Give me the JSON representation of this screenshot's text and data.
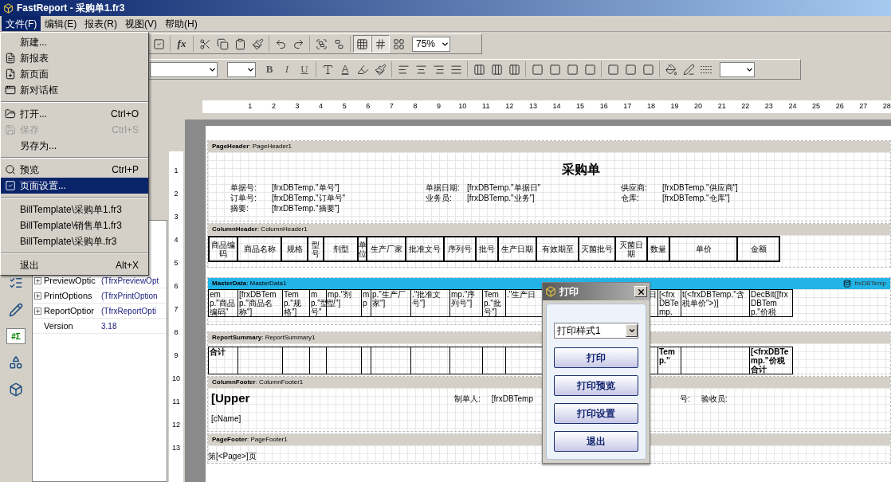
{
  "window": {
    "title": "FastReport - 采购单1.fr3"
  },
  "menu_bar": [
    {
      "label": "文件(F)",
      "selected": true
    },
    {
      "label": "编辑(E)",
      "selected": false
    },
    {
      "label": "报表(R)",
      "selected": false
    },
    {
      "label": "视图(V)",
      "selected": false
    },
    {
      "label": "帮助(H)",
      "selected": false
    }
  ],
  "file_menu": [
    {
      "kind": "item",
      "label": "新建...",
      "selected": false,
      "disabled": false
    },
    {
      "kind": "item",
      "label": "新报表",
      "selected": false,
      "disabled": false
    },
    {
      "kind": "item",
      "label": "新页面",
      "selected": false,
      "disabled": false
    },
    {
      "kind": "item",
      "label": "新对话框",
      "selected": false,
      "disabled": false
    },
    {
      "kind": "separator"
    },
    {
      "kind": "item",
      "label": "打开...",
      "shortcut": "Ctrl+O",
      "selected": false,
      "disabled": false
    },
    {
      "kind": "item",
      "label": "保存",
      "shortcut": "Ctrl+S",
      "selected": false,
      "disabled": true
    },
    {
      "kind": "item",
      "label": "另存为...",
      "selected": false,
      "disabled": false
    },
    {
      "kind": "separator"
    },
    {
      "kind": "item",
      "label": "预览",
      "shortcut": "Ctrl+P",
      "selected": false,
      "disabled": false
    },
    {
      "kind": "item",
      "label": "页面设置...",
      "selected": true,
      "disabled": false
    },
    {
      "kind": "separator"
    },
    {
      "kind": "item",
      "label": "BillTemplate\\采购单1.fr3",
      "selected": false,
      "disabled": false
    },
    {
      "kind": "item",
      "label": "BillTemplate\\销售单1.fr3",
      "selected": false,
      "disabled": false
    },
    {
      "kind": "item",
      "label": "BillTemplate\\采购单.fr3",
      "selected": false,
      "disabled": false
    },
    {
      "kind": "separator"
    },
    {
      "kind": "item",
      "label": "退出",
      "shortcut": "Alt+X",
      "selected": false,
      "disabled": false
    }
  ],
  "toolbar": {
    "function_button": "fx",
    "grid_toggles": [
      {
        "selected": true
      },
      {
        "selected": true
      },
      {
        "selected": false
      }
    ],
    "zoom": "75%",
    "format_buttons": [
      "B",
      "I",
      "U"
    ],
    "font_color_button": "A"
  },
  "tool_palette": {
    "totals_button": "#Σ"
  },
  "object_inspector": {
    "rows": [
      {
        "name": "PreviewOptic",
        "value": "(TfrxPreviewOpt",
        "expandable": true
      },
      {
        "name": "PrintOptions",
        "value": "(TfrxPrintOption",
        "expandable": true
      },
      {
        "name": "ReportOptior",
        "value": "(TfrxReportOpti",
        "expandable": true
      },
      {
        "name": "Version",
        "value": "3.18",
        "expandable": false
      }
    ]
  },
  "rulers": {
    "horizontal": [
      "1",
      "2",
      "3",
      "4",
      "5",
      "6",
      "7",
      "8",
      "9",
      "10",
      "11",
      "12",
      "13",
      "14",
      "15",
      "16",
      "17",
      "18",
      "19",
      "20",
      "21",
      "22",
      "23",
      "24",
      "25",
      "26",
      "27",
      "28"
    ],
    "vertical": [
      "1",
      "2",
      "3",
      "4",
      "5",
      "6",
      "7",
      "8",
      "9",
      "10",
      "11",
      "12",
      "13"
    ]
  },
  "report": {
    "bands": [
      {
        "kind": "page_header",
        "header": "**PageHeader**: PageHeader1",
        "title": "采购单",
        "field_rows": [
          [
            {
              "label": "单据号:",
              "value": "[frxDBTemp.\"单号\"]"
            },
            {
              "label": "单据日期:",
              "value": "[frxDBTemp.\"单据日\""
            },
            {
              "label": "供应商:",
              "value": "[frxDBTemp.\"供应商\"]"
            }
          ],
          [
            {
              "label": "订单号:",
              "value": "[frxDBTemp.\"订单号\""
            },
            {
              "label": "业务员:",
              "value": "[frxDBTemp.\"业务\"]"
            },
            {
              "label": "仓库:",
              "value": "[frxDBTemp.\"仓库\"]"
            }
          ],
          [
            {
              "label": "摘要:",
              "value": "[frxDBTemp.\"摘要\"]"
            }
          ]
        ]
      },
      {
        "kind": "column_header",
        "header": "**ColumnHeader**: ColumnHeader1",
        "columns": [
          "商品编码",
          "商品名称",
          "规格",
          "型号",
          "剂型",
          "单位",
          "生产厂家",
          "批准文号",
          "序列号",
          "批号",
          "生产日期",
          "有效期至",
          "灭菌批号",
          "灭菌日期",
          "数量",
          "单价",
          "金额"
        ]
      },
      {
        "kind": "master_data",
        "header": "**MasterData**: MasterData1",
        "datasource": "frxDBTemp",
        "cells": [
          {
            "text": "emp.\"商品编码\""
          },
          {
            "text": "[frxDBTemp.\"商品名称\"]"
          },
          {
            "text": "Temp.\"规格\"]"
          },
          {
            "text": "mp.\"型号\""
          },
          {
            "text": "mp.\"剂型\"]"
          },
          {
            "text": "mp"
          },
          {
            "text": "p.\"生产厂家\"]"
          },
          {
            "text": ".\"批准文号\"]"
          },
          {
            "text": "mp.\"序列号\"]"
          },
          {
            "text": "Temp.\"批号\"]"
          },
          {
            "text": ".\"生产日"
          },
          {},
          {},
          {
            "text": "日"
          },
          {
            "text": "[<frxDBTemp."
          },
          {
            "text": "t(<frxDBTemp.\"含税单价\">)]"
          },
          {
            "text": "DecBit([frxDBTemp.\"价税"
          }
        ]
      },
      {
        "kind": "report_summary",
        "header": "**ReportSummary**: ReportSummary1",
        "cells": [
          {
            "text": "合计"
          },
          {},
          {},
          {},
          {},
          {},
          {},
          {},
          {},
          {},
          {},
          {},
          {},
          {},
          {
            "text": "Temp.\""
          },
          {},
          {
            "text": "[<frxDBTemp.\"价税合计"
          }
        ]
      },
      {
        "kind": "column_footer",
        "header": "**ColumnFooter**: ColumnFooter1",
        "upper": "[Upper",
        "signatures": [
          "制单人:",
          "[frxDBTemp",
          "号:",
          "验收员:"
        ],
        "note": "[cName]"
      },
      {
        "kind": "page_footer",
        "header": "**PageFooter**: PageFooter1",
        "page": "第[<Page>]页"
      }
    ]
  },
  "print_dialog": {
    "title": "打印",
    "style_select": "打印样式1",
    "buttons": [
      "打印",
      "打印预览",
      "打印设置",
      "退出"
    ]
  }
}
